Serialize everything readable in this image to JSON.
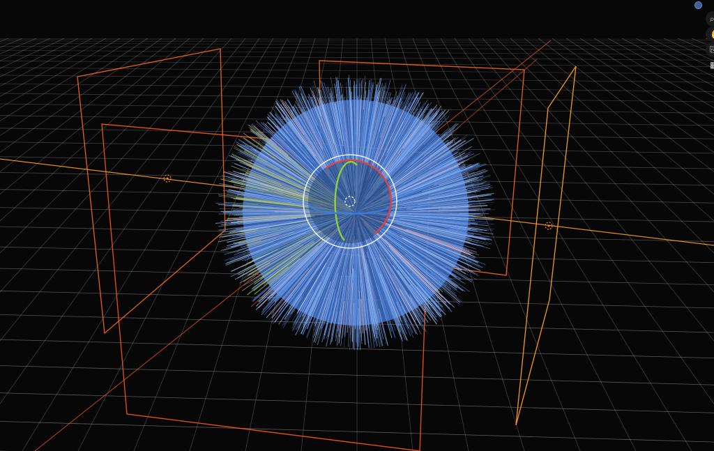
{
  "viewport": {
    "background": "#070707",
    "grid_color": "#ffffff",
    "object_color": "#5b8fe6",
    "light_frame_color": "#ff6a1a",
    "light_frame_alt_color": "#ffa21a"
  },
  "gizmo": {
    "x_axis_color": "#e0443f",
    "y_axis_color": "#8fd13a",
    "z_axis_color": "#3b7be0",
    "ring_color": "#ffffff"
  },
  "navigation": {
    "view_indicator_color": "#3f5f9a",
    "buttons": [
      {
        "icon": "zoom-icon",
        "glyph": "⌕"
      },
      {
        "icon": "pan-hand-icon",
        "glyph": "✋"
      },
      {
        "icon": "camera-icon",
        "glyph": "⎘"
      },
      {
        "icon": "grid-view-icon",
        "glyph": "▦"
      }
    ]
  }
}
